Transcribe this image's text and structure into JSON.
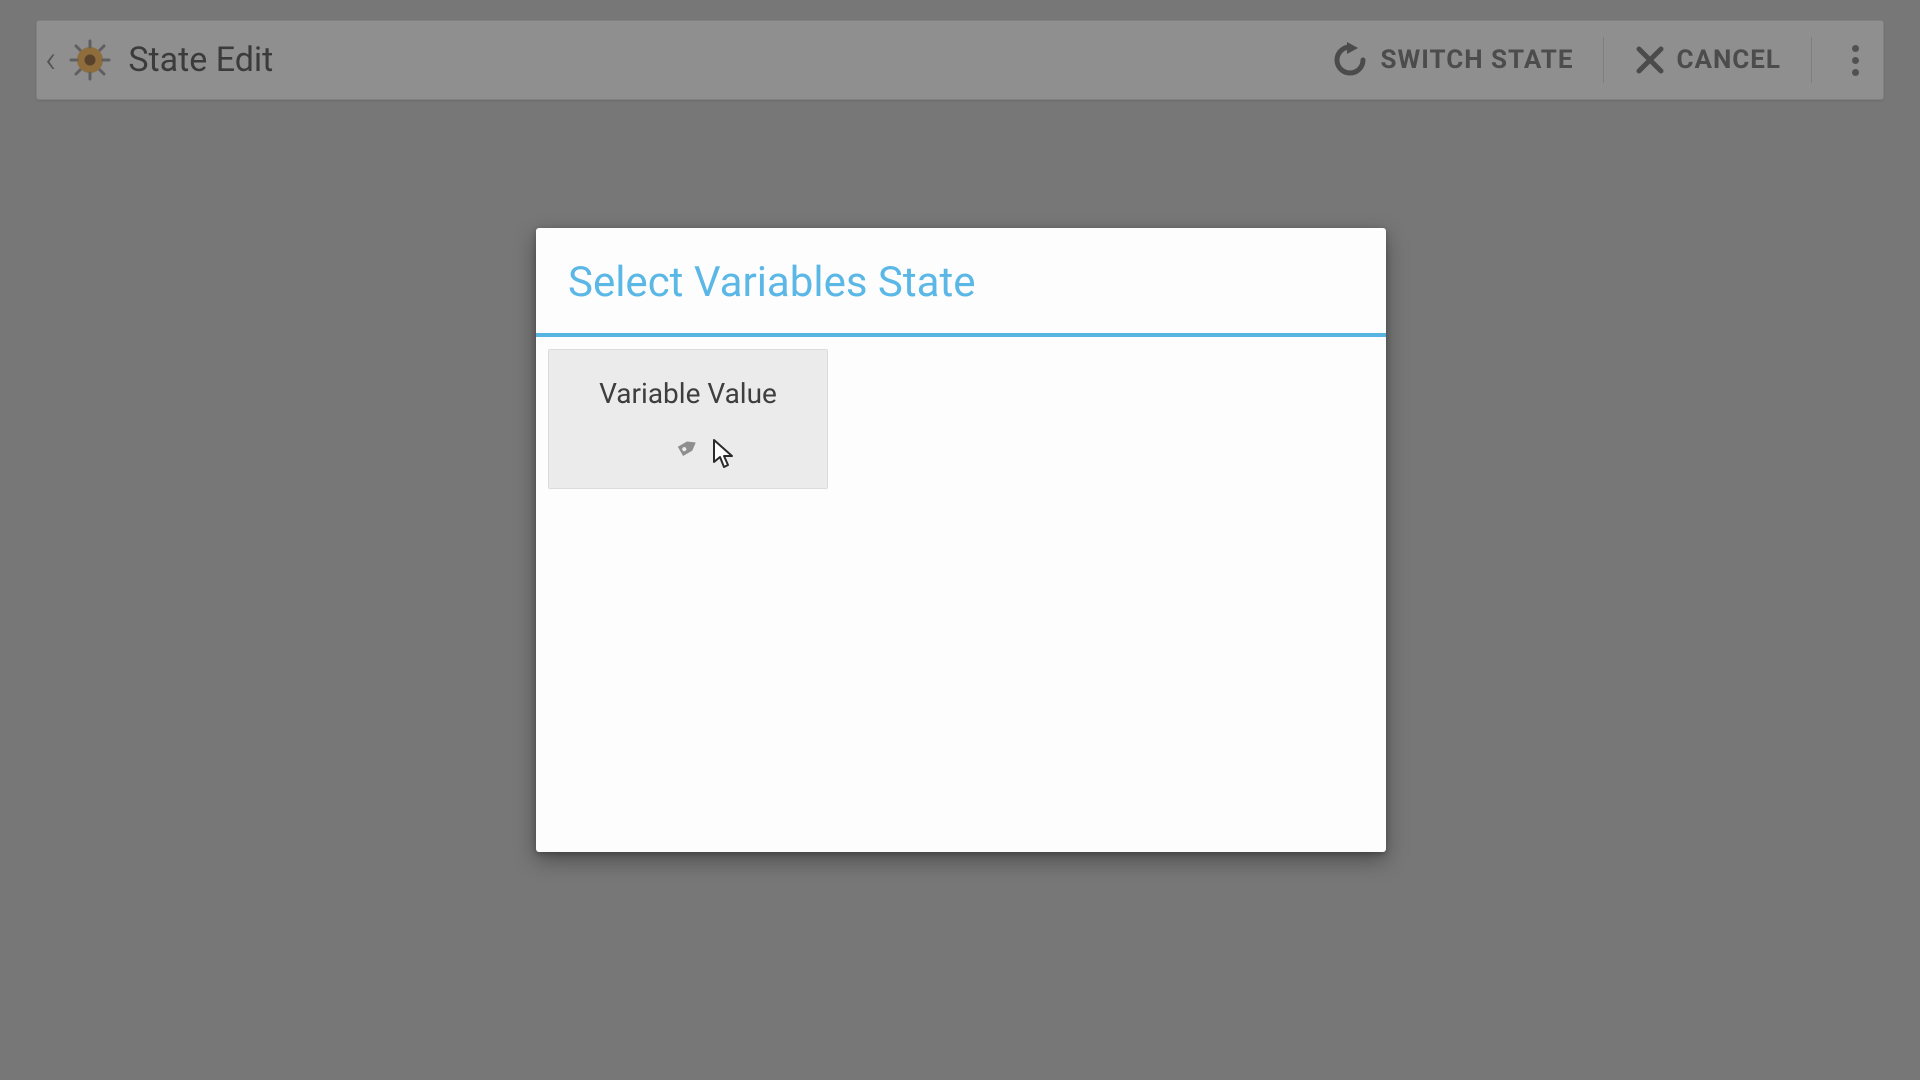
{
  "header": {
    "title": "State Edit",
    "switch_state_label": "SWITCH STATE",
    "cancel_label": "CANCEL"
  },
  "dialog": {
    "title": "Select Variables State",
    "options": [
      {
        "label": "Variable Value",
        "icon": "tag-icon"
      }
    ]
  }
}
